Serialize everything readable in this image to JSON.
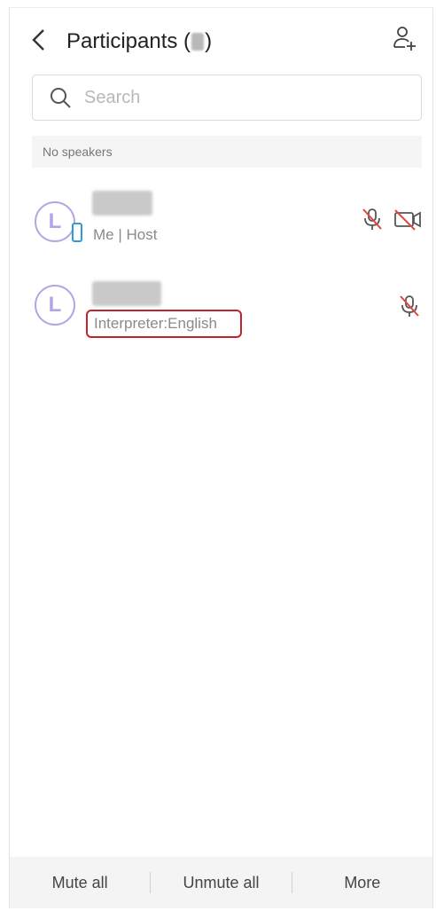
{
  "header": {
    "title": "Participants (",
    "title_suffix": ")"
  },
  "search": {
    "placeholder": "Search"
  },
  "section": {
    "label": "No speakers"
  },
  "participants": [
    {
      "avatar_letter": "L",
      "subtitle": "Me | Host",
      "device": "phone-icon",
      "mic": "muted",
      "camera": "off"
    },
    {
      "avatar_letter": "L",
      "subtitle": "Interpreter:English",
      "mic": "muted"
    }
  ],
  "footer": {
    "mute_all": "Mute all",
    "unmute_all": "Unmute all",
    "more": "More"
  },
  "colors": {
    "avatar_border": "#b7a4e6",
    "muted_red": "#e0463e",
    "highlight_border": "#c3232b",
    "phone_badge": "#2e9ad6"
  }
}
